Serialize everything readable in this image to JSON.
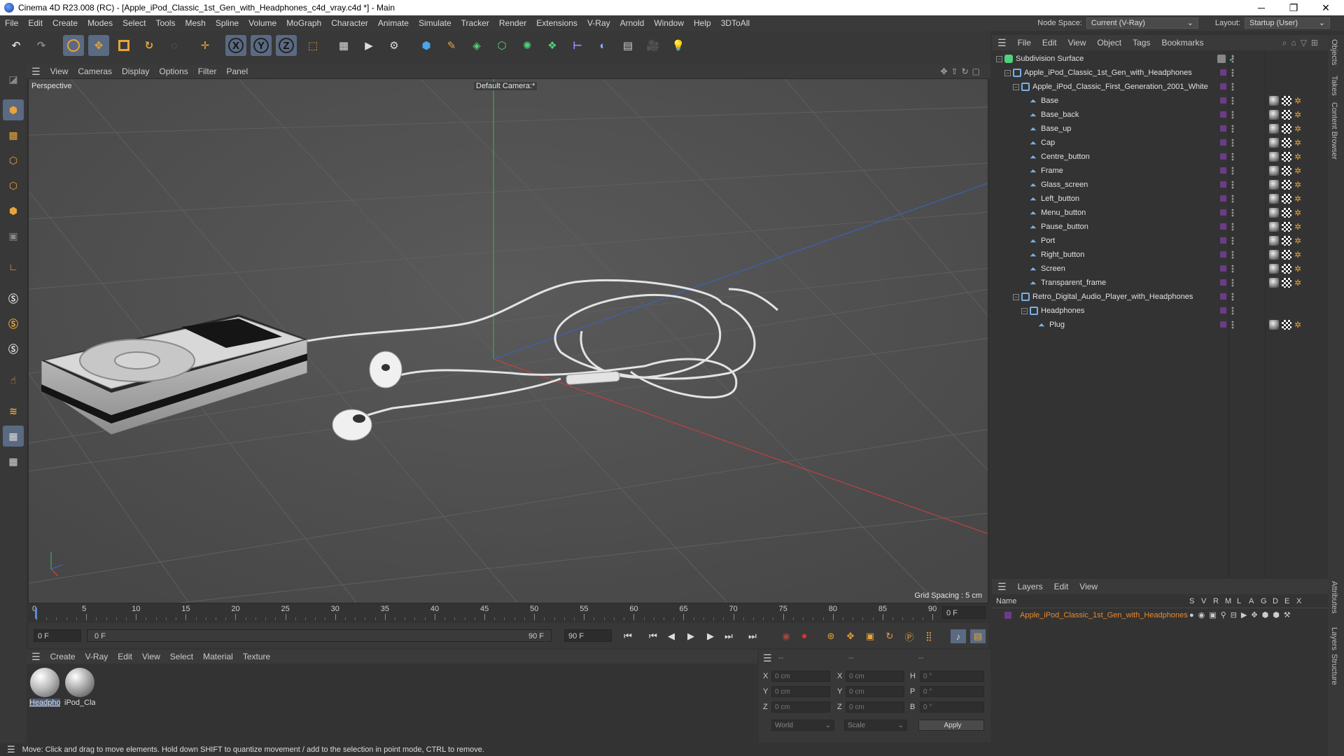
{
  "window": {
    "title": "Cinema 4D R23.008 (RC) - [Apple_iPod_Classic_1st_Gen_with_Headphones_c4d_vray.c4d *] - Main",
    "minimize": "─",
    "maximize": "❐",
    "close": "✕"
  },
  "menubar": {
    "items": [
      "File",
      "Edit",
      "Create",
      "Modes",
      "Select",
      "Tools",
      "Mesh",
      "Spline",
      "Volume",
      "MoGraph",
      "Character",
      "Animate",
      "Simulate",
      "Tracker",
      "Render",
      "Extensions",
      "V-Ray",
      "Arnold",
      "Window",
      "Help",
      "3DToAll"
    ],
    "node_space_label": "Node Space:",
    "node_space_value": "Current (V-Ray)",
    "layout_label": "Layout:",
    "layout_value": "Startup (User)"
  },
  "toolbar": {
    "axis_x": "X",
    "axis_y": "Y",
    "axis_z": "Z"
  },
  "viewport": {
    "menu": [
      "View",
      "Cameras",
      "Display",
      "Options",
      "Filter",
      "Panel"
    ],
    "view_name": "Perspective",
    "camera": "Default Camera",
    "camera_suffix": ":*",
    "grid_spacing": "Grid Spacing : 5 cm"
  },
  "timeline": {
    "ticks": [
      "0",
      "5",
      "10",
      "15",
      "20",
      "25",
      "30",
      "35",
      "40",
      "45",
      "50",
      "55",
      "60",
      "65",
      "70",
      "75",
      "80",
      "85",
      "90"
    ],
    "current_frame_right": "0 F",
    "start_frame": "0 F",
    "range_start": "0 F",
    "range_end": "90 F",
    "end_frame": "90 F"
  },
  "materials": {
    "menu": [
      "Create",
      "V-Ray",
      "Edit",
      "View",
      "Select",
      "Material",
      "Texture"
    ],
    "items": [
      {
        "label": "Headpho"
      },
      {
        "label": "iPod_Cla"
      }
    ]
  },
  "coordinates": {
    "header": [
      "--",
      "--",
      "--"
    ],
    "rows": [
      {
        "a": "X",
        "av": "0 cm",
        "b": "X",
        "bv": "0 cm",
        "c": "H",
        "cv": "0 °"
      },
      {
        "a": "Y",
        "av": "0 cm",
        "b": "Y",
        "bv": "0 cm",
        "c": "P",
        "cv": "0 °"
      },
      {
        "a": "Z",
        "av": "0 cm",
        "b": "Z",
        "bv": "0 cm",
        "c": "B",
        "cv": "0 °"
      }
    ],
    "world": "World",
    "scale": "Scale",
    "apply": "Apply"
  },
  "status": {
    "text": "Move: Click and drag to move elements. Hold down SHIFT to quantize movement / add to the selection in point mode, CTRL to remove."
  },
  "object_manager": {
    "menu": [
      "File",
      "Edit",
      "View",
      "Object",
      "Tags",
      "Bookmarks"
    ],
    "objects": [
      {
        "name": "Subdivision Surface",
        "level": 0,
        "type": "subdiv",
        "tags": false
      },
      {
        "name": "Apple_iPod_Classic_1st_Gen_with_Headphones",
        "level": 1,
        "type": "null",
        "tags": false
      },
      {
        "name": "Apple_iPod_Classic_First_Generation_2001_White",
        "level": 2,
        "type": "null",
        "tags": false
      },
      {
        "name": "Base",
        "level": 3,
        "type": "mesh",
        "tags": true
      },
      {
        "name": "Base_back",
        "level": 3,
        "type": "mesh",
        "tags": true
      },
      {
        "name": "Base_up",
        "level": 3,
        "type": "mesh",
        "tags": true
      },
      {
        "name": "Cap",
        "level": 3,
        "type": "mesh",
        "tags": true
      },
      {
        "name": "Centre_button",
        "level": 3,
        "type": "mesh",
        "tags": true
      },
      {
        "name": "Frame",
        "level": 3,
        "type": "mesh",
        "tags": true
      },
      {
        "name": "Glass_screen",
        "level": 3,
        "type": "mesh",
        "tags": true
      },
      {
        "name": "Left_button",
        "level": 3,
        "type": "mesh",
        "tags": true
      },
      {
        "name": "Menu_button",
        "level": 3,
        "type": "mesh",
        "tags": true
      },
      {
        "name": "Pause_button",
        "level": 3,
        "type": "mesh",
        "tags": true
      },
      {
        "name": "Port",
        "level": 3,
        "type": "mesh",
        "tags": true
      },
      {
        "name": "Right_button",
        "level": 3,
        "type": "mesh",
        "tags": true
      },
      {
        "name": "Screen",
        "level": 3,
        "type": "mesh",
        "tags": true
      },
      {
        "name": "Transparent_frame",
        "level": 3,
        "type": "mesh",
        "tags": true
      },
      {
        "name": "Retro_Digital_Audio_Player_with_Headphones",
        "level": 2,
        "type": "null",
        "tags": false
      },
      {
        "name": "Headphones",
        "level": 3,
        "type": "null",
        "tags": false
      },
      {
        "name": "Plug",
        "level": 4,
        "type": "mesh",
        "tags": true
      }
    ]
  },
  "layers": {
    "menu": [
      "Layers",
      "Edit",
      "View"
    ],
    "col_name": "Name",
    "col_flags": [
      "S",
      "V",
      "R",
      "M",
      "L",
      "A",
      "G",
      "D",
      "E",
      "X"
    ],
    "items": [
      {
        "name": "Apple_iPod_Classic_1st_Gen_with_Headphones"
      }
    ]
  },
  "side_tabs": [
    "Objects",
    "Takes",
    "Content Browser",
    "Attributes",
    "Layers",
    "Structure"
  ]
}
